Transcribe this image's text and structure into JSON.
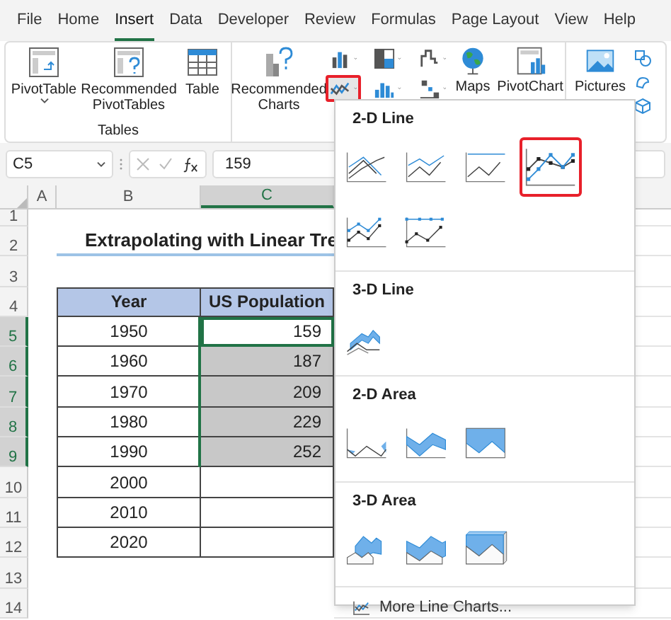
{
  "ribbon_tabs": [
    {
      "label": "File",
      "selected": false
    },
    {
      "label": "Home",
      "selected": false
    },
    {
      "label": "Insert",
      "selected": true
    },
    {
      "label": "Data",
      "selected": false
    },
    {
      "label": "Developer",
      "selected": false
    },
    {
      "label": "Review",
      "selected": false
    },
    {
      "label": "Formulas",
      "selected": false
    },
    {
      "label": "Page Layout",
      "selected": false
    },
    {
      "label": "View",
      "selected": false
    },
    {
      "label": "Help",
      "selected": false
    }
  ],
  "ribbon": {
    "tables_group": {
      "label": "Tables",
      "buttons": [
        {
          "label": "PivotTable",
          "dropdown": true
        },
        {
          "label": "Recommended PivotTables",
          "dropdown": false
        },
        {
          "label": "Table",
          "dropdown": false
        }
      ]
    },
    "recommended_charts": "Recommended Charts",
    "chart_buttons": [
      {
        "kind": "column",
        "highlighted": false
      },
      {
        "kind": "hierarchy",
        "highlighted": false
      },
      {
        "kind": "waterfall",
        "highlighted": false
      },
      {
        "kind": "line",
        "highlighted": true
      },
      {
        "kind": "statistic",
        "highlighted": false
      },
      {
        "kind": "scatter",
        "highlighted": false
      }
    ],
    "maps": "Maps",
    "pivotchart": "PivotChart",
    "pictures": "Pictures"
  },
  "formula_bar": {
    "name_box": "C5",
    "formula": "159"
  },
  "sheet": {
    "columns": [
      {
        "label": "A",
        "selected": false
      },
      {
        "label": "B",
        "selected": false
      },
      {
        "label": "C",
        "selected": true
      }
    ],
    "row_numbers": [
      {
        "label": "1",
        "selected": false
      },
      {
        "label": "2",
        "selected": false
      },
      {
        "label": "3",
        "selected": false
      },
      {
        "label": "4",
        "selected": false
      },
      {
        "label": "5",
        "selected": true
      },
      {
        "label": "6",
        "selected": true
      },
      {
        "label": "7",
        "selected": true
      },
      {
        "label": "8",
        "selected": true
      },
      {
        "label": "9",
        "selected": true
      },
      {
        "label": "10",
        "selected": false
      },
      {
        "label": "11",
        "selected": false
      },
      {
        "label": "12",
        "selected": false
      },
      {
        "label": "13",
        "selected": false
      },
      {
        "label": "14",
        "selected": false
      }
    ],
    "title": "Extrapolating with Linear Tre",
    "table_headers": [
      "Year",
      "US Population"
    ],
    "rows": [
      {
        "year": "1950",
        "population": "159",
        "selected": true,
        "active": true
      },
      {
        "year": "1960",
        "population": "187",
        "selected": true,
        "active": false
      },
      {
        "year": "1970",
        "population": "209",
        "selected": true,
        "active": false
      },
      {
        "year": "1980",
        "population": "229",
        "selected": true,
        "active": false
      },
      {
        "year": "1990",
        "population": "252",
        "selected": true,
        "active": false
      },
      {
        "year": "2000",
        "selected": false,
        "active": false
      },
      {
        "year": "2010",
        "selected": false,
        "active": false
      },
      {
        "year": "2020",
        "selected": false,
        "active": false
      }
    ]
  },
  "line_menu": {
    "sections": [
      {
        "title": "2-D Line",
        "items": [
          {
            "kind": "line",
            "highlighted": false
          },
          {
            "kind": "stacked-line",
            "highlighted": false
          },
          {
            "kind": "full-line",
            "highlighted": false
          },
          {
            "kind": "line-markers",
            "highlighted": true
          },
          {
            "kind": "stacked-markers",
            "highlighted": false
          },
          {
            "kind": "full-markers",
            "highlighted": false
          }
        ]
      },
      {
        "title": "3-D Line",
        "items": [
          {
            "kind": "perspective-line",
            "highlighted": false
          }
        ]
      },
      {
        "title": "2-D Area",
        "items": [
          {
            "kind": "area",
            "highlighted": false
          },
          {
            "kind": "stacked-area",
            "highlighted": false
          },
          {
            "kind": "full-area",
            "highlighted": false
          }
        ]
      },
      {
        "title": "3-D Area",
        "items": [
          {
            "kind": "perspective-area",
            "highlighted": false
          },
          {
            "kind": "perspective-stacked-area",
            "highlighted": false
          },
          {
            "kind": "perspective-full-area",
            "highlighted": false
          }
        ]
      }
    ],
    "footer": "More Line Charts..."
  }
}
